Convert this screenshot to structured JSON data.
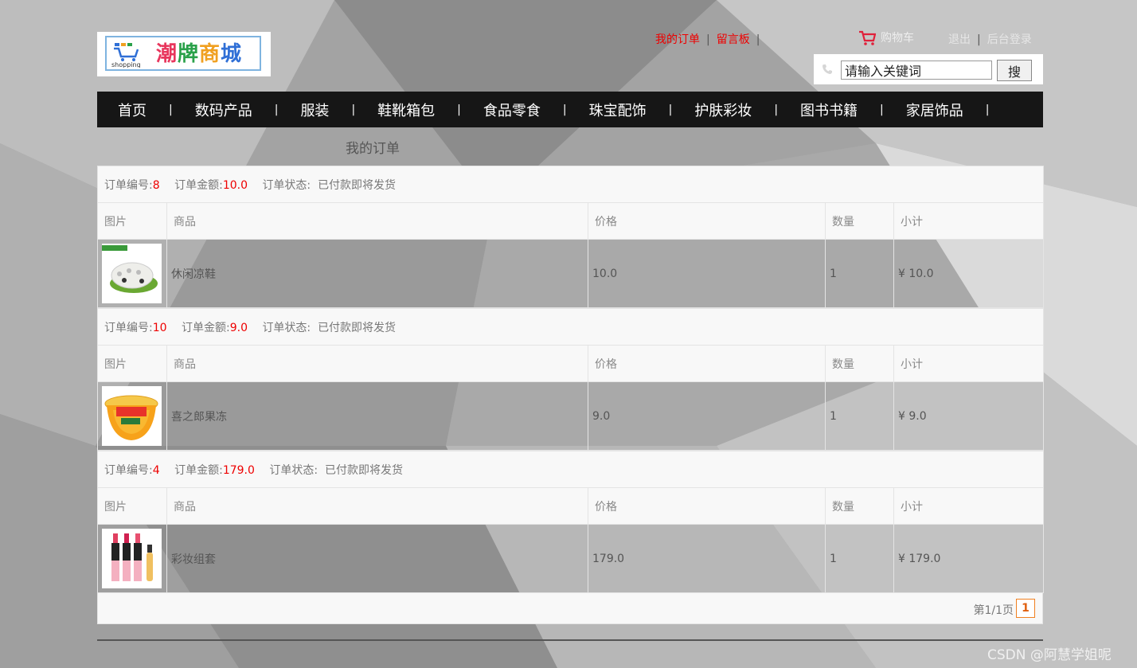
{
  "brand": {
    "logo_text": "潮牌商城",
    "logo_sub": "shopping"
  },
  "toplinks": {
    "my_orders": "我的订单",
    "message_board": "留言板",
    "cart": "购物车",
    "logout": "退出",
    "admin_login": "后台登录",
    "sep": "|"
  },
  "search": {
    "value": "请输入关键词",
    "button": "搜"
  },
  "nav": [
    "首页",
    "数码产品",
    "服装",
    "鞋靴箱包",
    "食品零食",
    "珠宝配饰",
    "护肤彩妆",
    "图书书籍",
    "家居饰品"
  ],
  "nav_sep": "|",
  "page_title": "我的订单",
  "labels": {
    "order_no": "订单编号:",
    "order_amount": "订单金额:",
    "order_status": "订单状态:",
    "col_pic": "图片",
    "col_product": "商品",
    "col_price": "价格",
    "col_qty": "数量",
    "col_subtotal": "小计"
  },
  "orders": [
    {
      "no": "8",
      "amount": "10.0",
      "status": "已付款即将发货",
      "product": "休闲凉鞋",
      "price": "10.0",
      "qty": "1",
      "subtotal": "¥ 10.0",
      "thumb": "sandal"
    },
    {
      "no": "10",
      "amount": "9.0",
      "status": "已付款即将发货",
      "product": "喜之郎果冻",
      "price": "9.0",
      "qty": "1",
      "subtotal": "¥ 9.0",
      "thumb": "jelly"
    },
    {
      "no": "4",
      "amount": "179.0",
      "status": "已付款即将发货",
      "product": "彩妆组套",
      "price": "179.0",
      "qty": "1",
      "subtotal": "¥ 179.0",
      "thumb": "lipstick"
    }
  ],
  "pager": {
    "text": "第1/1页",
    "current": "1"
  },
  "watermark": "CSDN @阿慧学姐呢",
  "colors": {
    "accent_red": "#ee0000",
    "nav_bg": "#161616",
    "pager_orange": "#f08020"
  }
}
